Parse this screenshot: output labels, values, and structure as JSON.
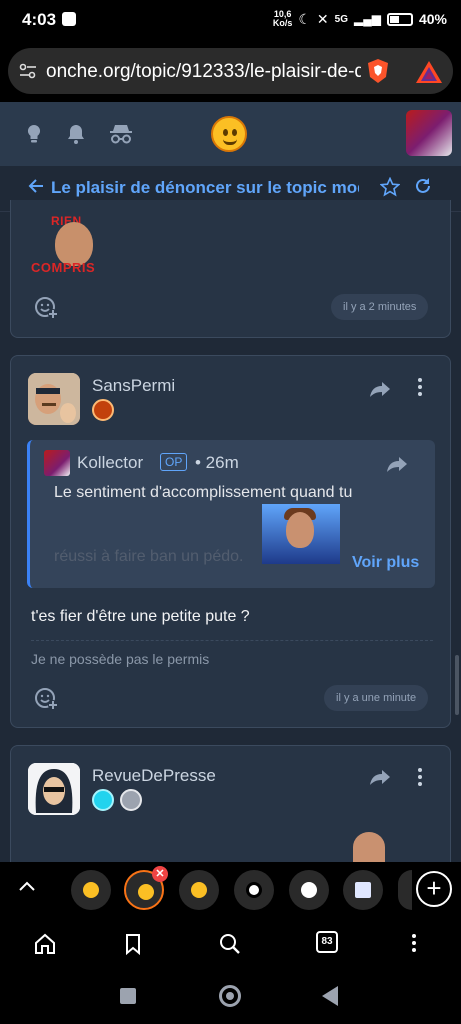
{
  "status_bar": {
    "time": "4:03",
    "net_speed_value": "10,6",
    "net_speed_unit": "Ko/s",
    "network": "5G",
    "battery": "40%"
  },
  "browser": {
    "url": "onche.org/topic/912333/le-plaisir-de-d"
  },
  "topic": {
    "title": "Le plaisir de dénoncer sur le topic modé"
  },
  "posts": [
    {
      "image_text_top": "RIEN",
      "image_text_bottom": "COMPRIS",
      "time": "il y a 2 minutes"
    },
    {
      "author": "SansPermi",
      "quote": {
        "author": "Kollector",
        "op_label": "OP",
        "time": "• 26m",
        "text_line1": "Le sentiment d'accomplissement quand tu",
        "text_line2": "réussi à faire ban un pédo.",
        "more_label": "Voir plus"
      },
      "message": "t'es fier d'être une petite pute ?",
      "signature": "Je ne possède pas le permis",
      "time": "il y a une minute"
    },
    {
      "author": "RevueDePresse"
    }
  ],
  "tab_strip": {
    "close_badge": "✕",
    "new_tab": "+"
  },
  "bottom_nav": {
    "tab_count": "83"
  },
  "colors": {
    "accent": "#60a5fa",
    "background": "#1f2937",
    "card": "#273445",
    "active_tab_ring": "#f97316"
  }
}
